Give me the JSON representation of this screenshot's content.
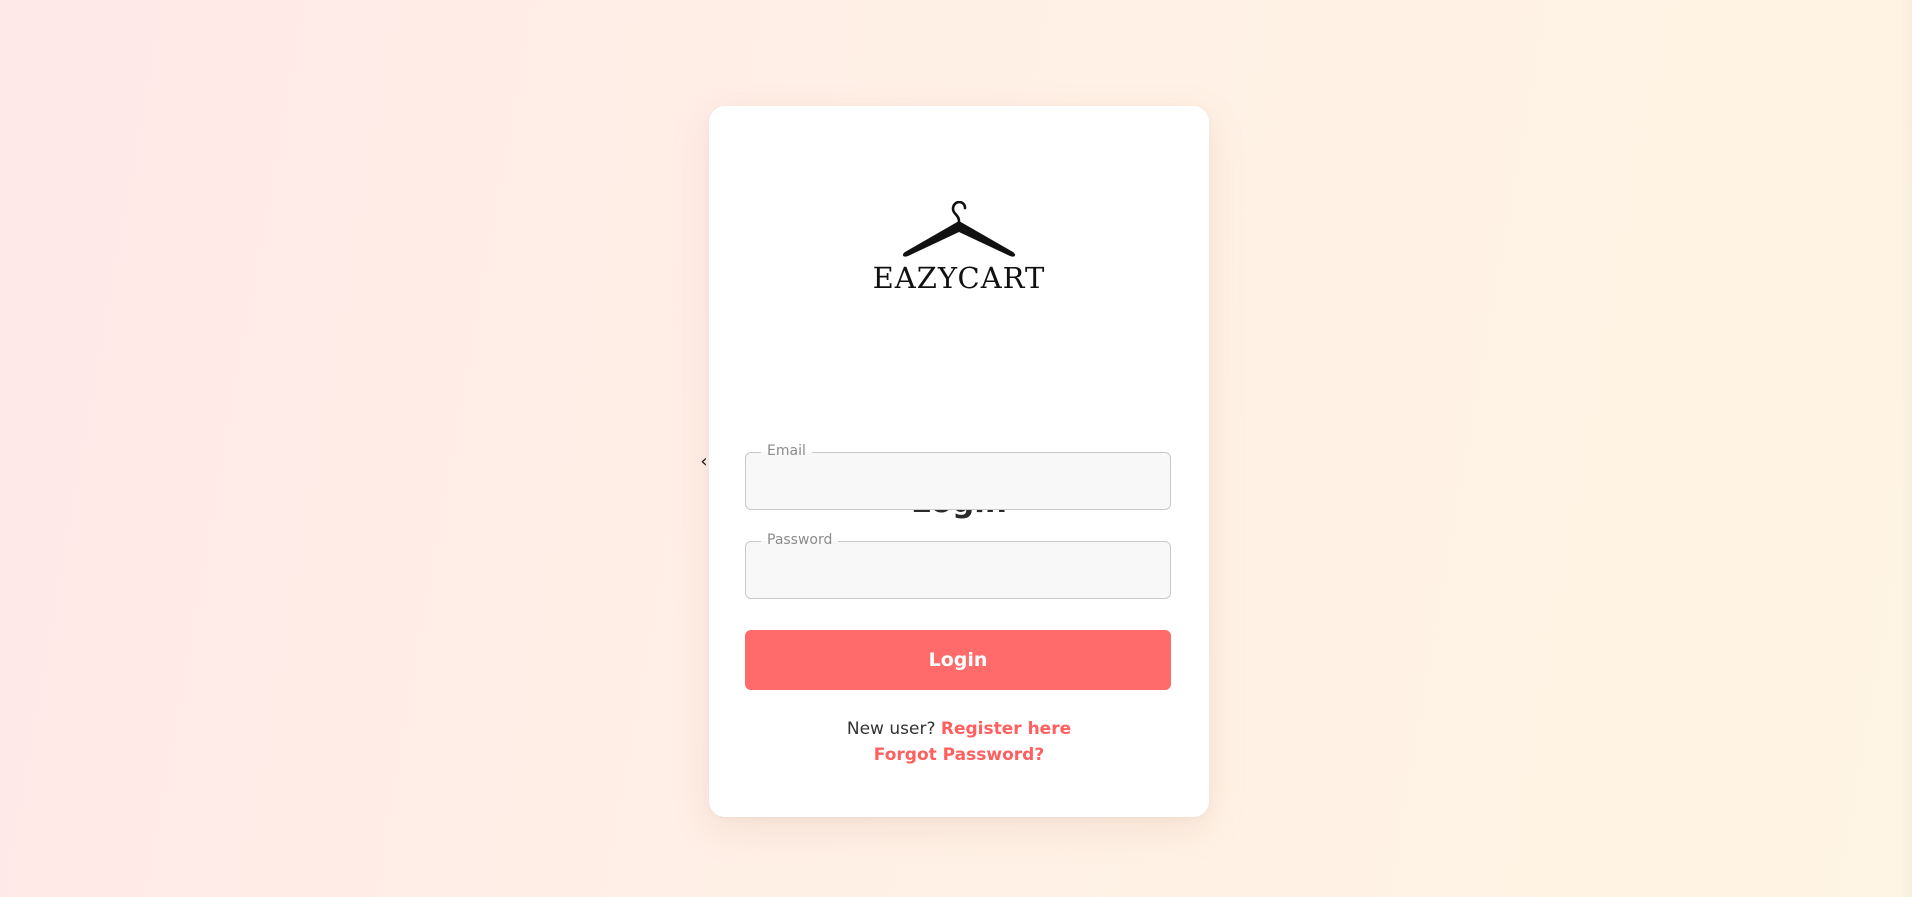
{
  "brand": {
    "name": "EAZYCART",
    "icon": "hanger-icon"
  },
  "nav": {
    "back_glyph": "‹",
    "back_icon": "chevron-left-icon"
  },
  "form": {
    "title": "Login",
    "email": {
      "label": "Email",
      "value": "",
      "placeholder": ""
    },
    "password": {
      "label": "Password",
      "value": "",
      "placeholder": ""
    },
    "submit_label": "Login"
  },
  "footer": {
    "new_user_text": "New user?",
    "register_link": "Register here",
    "forgot_link": "Forgot Password?"
  },
  "colors": {
    "accent": "#ff6b6b",
    "link": "#ff5f5f",
    "background_start": "#ffe8e8",
    "background_end": "#fff5e4"
  }
}
